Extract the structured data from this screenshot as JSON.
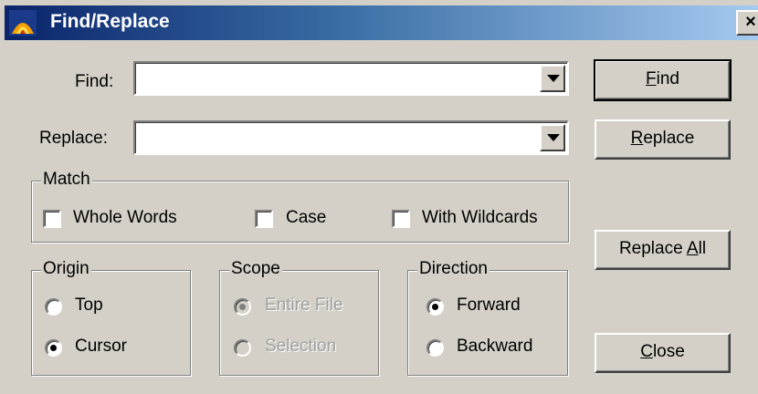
{
  "window": {
    "title": "Find/Replace",
    "close_glyph": "×",
    "icon": "app-icon"
  },
  "find": {
    "label": "Find:",
    "value": ""
  },
  "replace": {
    "label": "Replace:",
    "value": ""
  },
  "buttons": {
    "find": {
      "mnemonic": "F",
      "rest": "ind"
    },
    "replace": {
      "mnemonic": "R",
      "rest": "eplace"
    },
    "replace_all": {
      "prefix": "Replace ",
      "mnemonic": "A",
      "rest": "ll"
    },
    "close": {
      "mnemonic": "C",
      "rest": "lose"
    }
  },
  "match": {
    "title": "Match",
    "whole_words": {
      "label": "Whole Words",
      "checked": false
    },
    "case": {
      "label": "Case",
      "checked": false
    },
    "wildcards": {
      "label": "With Wildcards",
      "checked": false
    }
  },
  "origin": {
    "title": "Origin",
    "top": {
      "label": "Top",
      "selected": false
    },
    "cursor": {
      "label": "Cursor",
      "selected": true
    }
  },
  "scope": {
    "title": "Scope",
    "entire_file": {
      "label": "Entire File",
      "selected": true,
      "enabled": false
    },
    "selection": {
      "label": "Selection",
      "selected": false,
      "enabled": false
    }
  },
  "direction": {
    "title": "Direction",
    "forward": {
      "label": "Forward",
      "selected": true
    },
    "backward": {
      "label": "Backward",
      "selected": false
    }
  },
  "colors": {
    "titlebar_start": "#0a246a",
    "titlebar_end": "#a6caf0",
    "face": "#d4d0c8"
  }
}
